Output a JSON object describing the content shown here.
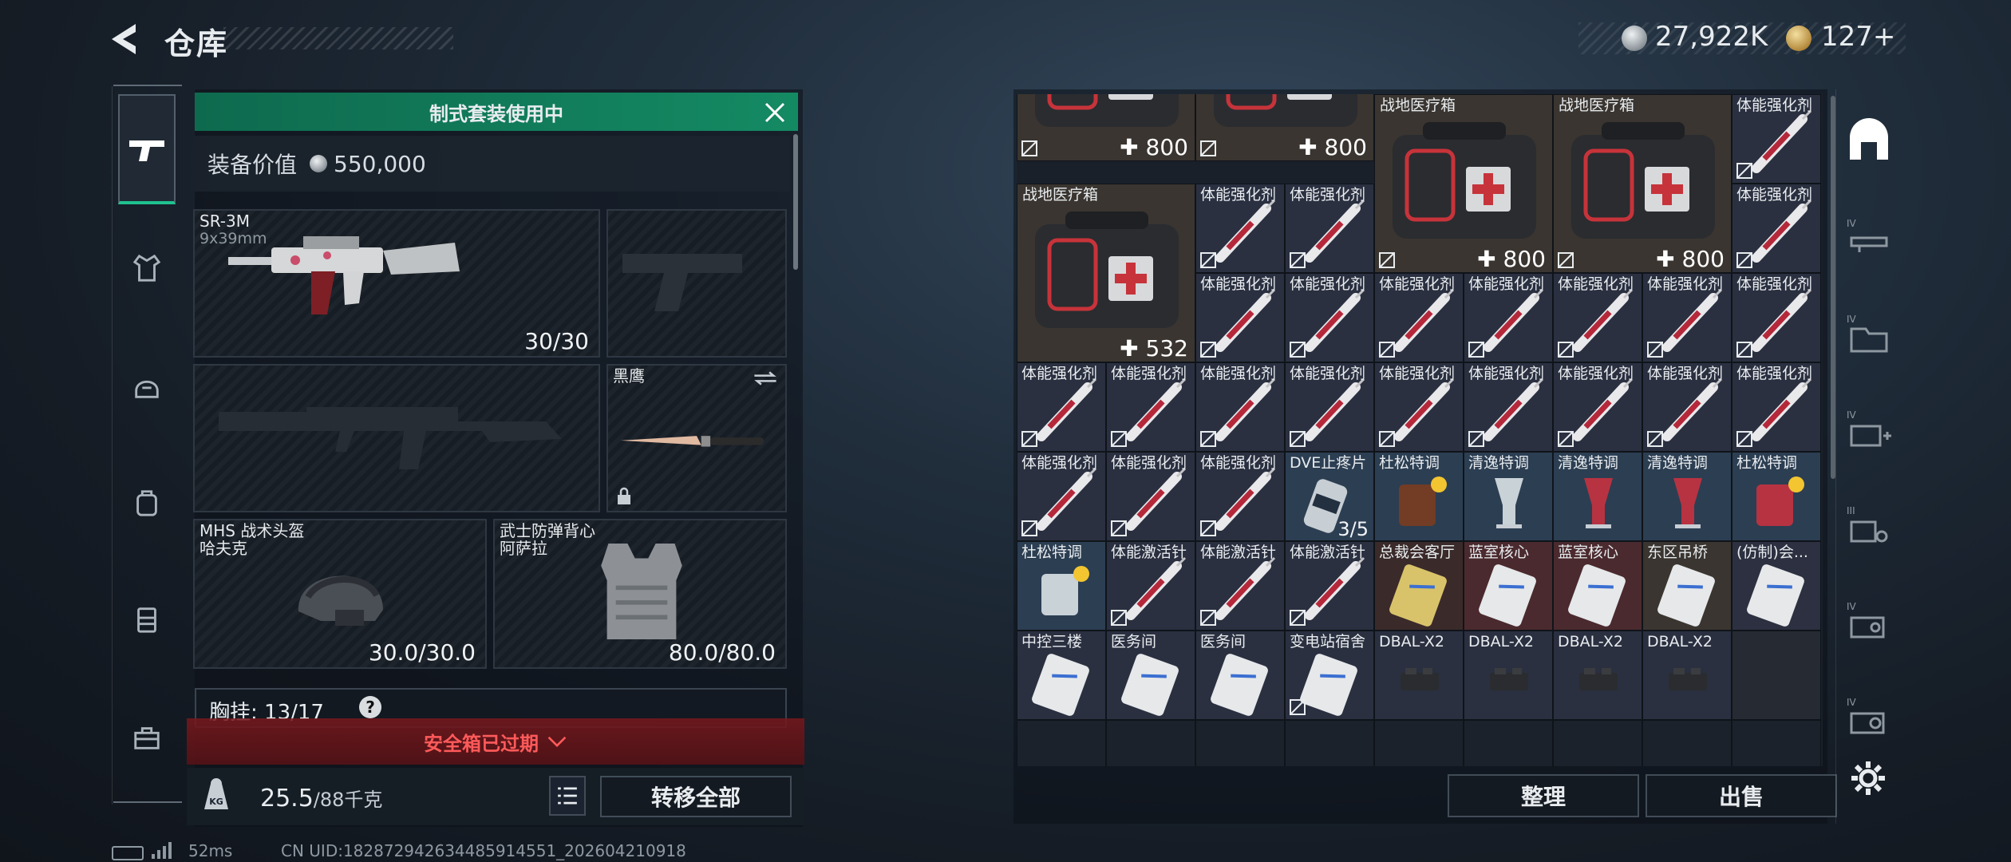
{
  "header": {
    "title": "仓库",
    "currency_silver": "27,922K",
    "currency_gold": "127+"
  },
  "nav": {
    "items": [
      "weapon-tab",
      "outfit-tab",
      "armor-tab",
      "backpack-tab",
      "rig-tab",
      "supply-tab"
    ]
  },
  "loadout": {
    "banner": "制式套装使用中",
    "value_label": "装备价值",
    "value": "550,000",
    "primary": {
      "name": "SR-3M",
      "ammo": "9x39mm",
      "durability": "30/30"
    },
    "melee": {
      "name": "黑鹰"
    },
    "helmet": {
      "name": "MHS 战术头盔",
      "sub": "哈夫克",
      "durability": "30.0/30.0"
    },
    "vest": {
      "name": "武士防弹背心",
      "sub": "阿萨拉",
      "durability": "80.0/80.0"
    },
    "chest": {
      "label": "胸挂:",
      "value": "13/17"
    },
    "help": "?"
  },
  "safebox": {
    "text": "安全箱已过期"
  },
  "weight": {
    "current": "25.5",
    "max": "/88千克"
  },
  "buttons": {
    "transfer": "转移全部",
    "sort": "整理",
    "sell": "出售"
  },
  "status": {
    "ping": "52ms",
    "uid": "CN UID:182872942634485914551_202604210918"
  },
  "storage": {
    "top_row": [
      {
        "name": "",
        "count": "800"
      },
      {
        "name": "",
        "count": "800"
      }
    ],
    "medkits": [
      {
        "name": "战地医疗箱",
        "count": "800"
      },
      {
        "name": "战地医疗箱",
        "count": "800"
      },
      {
        "name": "战地医疗箱",
        "count": "532"
      }
    ],
    "labels": {
      "stim": "体能强化剂",
      "dve": "DVE止疼片",
      "dve_count": "3/5",
      "dusong": "杜松特调",
      "qingyi": "清逸特调",
      "activator": "体能激活针",
      "card_boss": "总裁会客厅",
      "card_blue1": "蓝室核心",
      "card_blue2": "蓝室核心",
      "card_east": "东区吊桥",
      "card_fake": "(仿制)会...",
      "card_mid": "中控三楼",
      "card_med1": "医务间",
      "card_med2": "医务间",
      "card_sub": "变电站宿舍",
      "dbal": "DBAL-X2"
    }
  }
}
